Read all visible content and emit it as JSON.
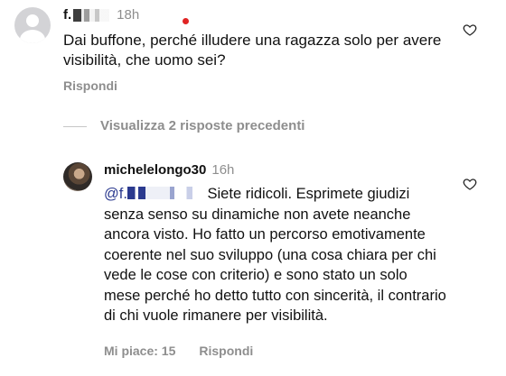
{
  "comment1": {
    "username": "f.",
    "time": "18h",
    "text": "Dai buffone, perché illudere una ragazza solo per avere visibilità, che uomo sei?",
    "reply_label": "Rispondi"
  },
  "view_replies": {
    "label": "Visualizza 2 risposte precedenti"
  },
  "comment2": {
    "username": "michelelongo30",
    "time": "16h",
    "mention": "@f.",
    "text": "Siete ridicoli. Esprimete giudizi senza senso su dinamiche non avete neanche ancora visto. Ho fatto un percorso emotivamente coerente nel suo sviluppo (una cosa chiara per chi vede le cose con criterio) e sono stato un solo mese perché ho detto tutto con sincerità, il contrario di chi vuole rimanere per visibilità.",
    "likes_label": "Mi piace: 15",
    "reply_label": "Rispondi"
  },
  "icons": {
    "like": "heart-outline-icon",
    "avatar_default": "default-avatar-icon"
  },
  "colors": {
    "secondary_text": "#8e8e8e",
    "mention": "#2b3a8f",
    "notification_dot": "#e02424"
  }
}
